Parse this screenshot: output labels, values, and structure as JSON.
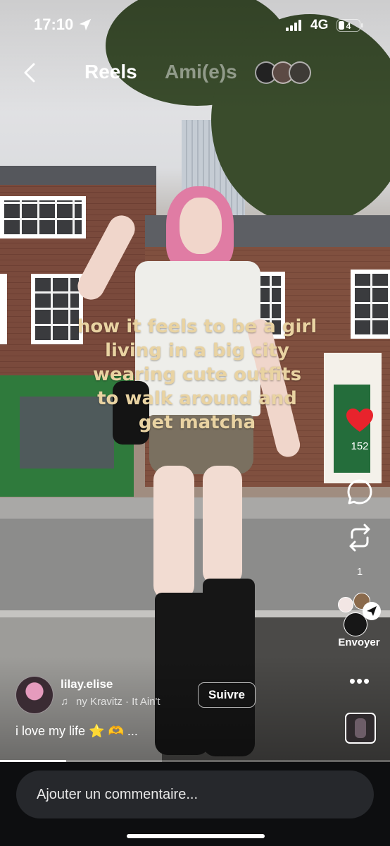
{
  "status_bar": {
    "time": "17:10",
    "network": "4G",
    "battery": "4"
  },
  "header": {
    "tabs": [
      {
        "label": "Reels",
        "active": true
      },
      {
        "label": "Ami(e)s",
        "active": false
      }
    ]
  },
  "overlay_text": [
    "how it feels to be a girl",
    "living in a big city",
    "wearing cute outfits",
    "to walk around and",
    "get matcha"
  ],
  "actions": {
    "like_count": "152",
    "repost_count": "1",
    "send_label": "Envoyer"
  },
  "author": {
    "username": "lilay.elise",
    "music": "ny Kravitz · It Ain't",
    "follow_label": "Suivre"
  },
  "caption": {
    "text": "i love my life",
    "emojis": "⭐ 🫶",
    "more": "..."
  },
  "progress": 0.17,
  "comment": {
    "placeholder": "Ajouter un commentaire..."
  },
  "colors": {
    "heart": "#e8232c",
    "overlay_text": "#e9d3a2",
    "bottom_bar": "#0d0e10",
    "input_bg": "#26282c"
  },
  "icons": [
    "location-arrow-icon",
    "signal-icon",
    "battery-icon",
    "back-chevron-icon",
    "heart-icon",
    "comment-icon",
    "repost-icon",
    "send-icon",
    "more-icon",
    "music-note-icon"
  ]
}
